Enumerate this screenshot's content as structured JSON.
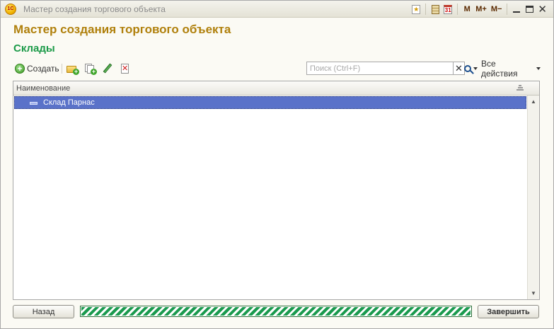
{
  "window": {
    "title": "Мастер создания торгового объекта",
    "controls": {
      "m": "M",
      "m_plus": "M+",
      "m_minus": "M−",
      "close": "✕",
      "calendar_day": "31"
    }
  },
  "header": {
    "title": "Мастер создания торгового объекта",
    "section": "Склады"
  },
  "toolbar": {
    "create_label": "Создать",
    "search_placeholder": "Поиск (Ctrl+F)",
    "search_value": "",
    "clear_label": "✕",
    "all_actions_label": "Все действия"
  },
  "table": {
    "columns": [
      "Наименование"
    ],
    "rows": [
      {
        "name": "Склад Парнас",
        "selected": true
      }
    ]
  },
  "footer": {
    "back_label": "Назад",
    "finish_label": "Завершить",
    "progress": 1.0
  },
  "colors": {
    "title": "#b0800c",
    "section": "#1b9a48",
    "selection": "#5a72c9",
    "progress": "#1a9a4e"
  }
}
